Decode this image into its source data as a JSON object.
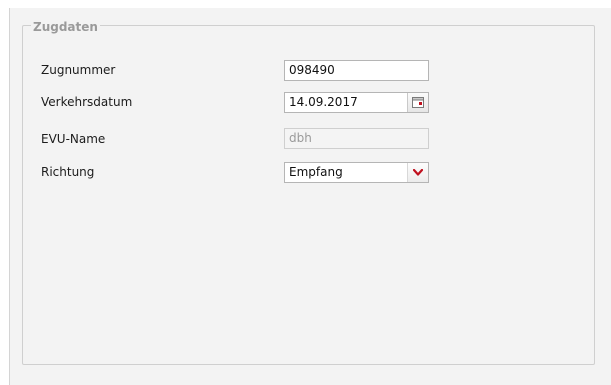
{
  "fieldset": {
    "legend": "Zugdaten"
  },
  "fields": {
    "zugnummer": {
      "label": "Zugnummer",
      "value": "098490"
    },
    "verkehrsdatum": {
      "label": "Verkehrsdatum",
      "value": "14.09.2017"
    },
    "evu_name": {
      "label": "EVU-Name",
      "value": "dbh"
    },
    "richtung": {
      "label": "Richtung",
      "value": "Empfang"
    }
  },
  "icons": {
    "calendar": "calendar-icon",
    "dropdown": "chevron-down-icon"
  },
  "colors": {
    "panel_background": "#f3f3f3",
    "legend_text": "#9a9a9a",
    "dropdown_arrow": "#c0101e"
  }
}
